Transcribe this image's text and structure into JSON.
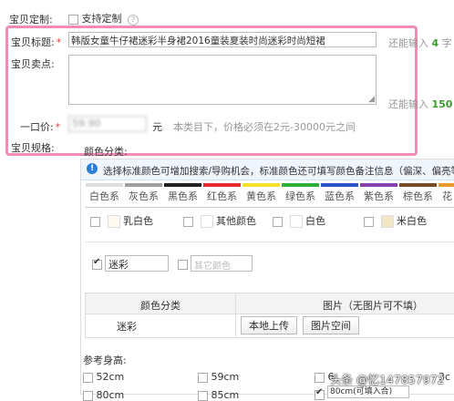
{
  "custom": {
    "label": "宝贝定制:",
    "checkbox_label": "支持定制"
  },
  "title": {
    "label": "宝贝标题:",
    "required": "*",
    "value": "韩版女童牛仔裙迷彩半身裙2016童装夏装时尚迷彩时尚短裙",
    "hint_prefix": "还能输入",
    "hint_count": "4",
    "hint_suffix": "字"
  },
  "selling": {
    "label": "宝贝卖点:",
    "hint_prefix": "还能输入",
    "hint_count": "150",
    "hint_suffix": "字"
  },
  "price": {
    "label": "一口价:",
    "required": "*",
    "value": "59.90",
    "unit": "元",
    "hint": "本类目下，价格必须在2元-30000元之间"
  },
  "spec": {
    "label": "宝贝规格:",
    "color_category": "颜色分类:"
  },
  "notice": {
    "text": "选择标准颜色可增加搜索/导购机会，标准颜色还可填写颜色备注信息（偏深、偏亮等）"
  },
  "color_tabs": [
    {
      "label": "白色系",
      "color": "#ffffff"
    },
    {
      "label": "灰色系",
      "color": "#9e9e9e"
    },
    {
      "label": "黑色系",
      "color": "#222222"
    },
    {
      "label": "红色系",
      "color": "#e52b2b"
    },
    {
      "label": "黄色系",
      "color": "#f5e12a"
    },
    {
      "label": "绿色系",
      "color": "#2fae3a"
    },
    {
      "label": "蓝色系",
      "color": "#2a55c8"
    },
    {
      "label": "紫色系",
      "color": "#8a3fb1"
    },
    {
      "label": "棕色系",
      "color": "#7a4a23"
    },
    {
      "label": "花",
      "color": "#e89a2c"
    }
  ],
  "white_colors": [
    {
      "label": "乳白色",
      "swatch": "#fffbf0"
    },
    {
      "label": "其他颜色",
      "swatch": "#ffffff"
    },
    {
      "label": "白色",
      "swatch": "#ffffff"
    },
    {
      "label": "米白色",
      "swatch": "#f3e6c4"
    }
  ],
  "custom_colors": {
    "checked_value": "迷彩",
    "other_placeholder": "其它颜色"
  },
  "table": {
    "col1": "颜色分类",
    "col2": "图片（无图片可不填）",
    "row_color": "迷彩",
    "upload_local": "本地上传",
    "upload_space": "图片空间"
  },
  "sizes": {
    "label": "参考身高:",
    "items": [
      "52cm",
      "59cm",
      "6",
      "3c"
    ],
    "row2": [
      "80cm",
      "85cm"
    ],
    "row2_input": "80cm(可填入合)"
  },
  "watermark": "头条 @忆147857972"
}
